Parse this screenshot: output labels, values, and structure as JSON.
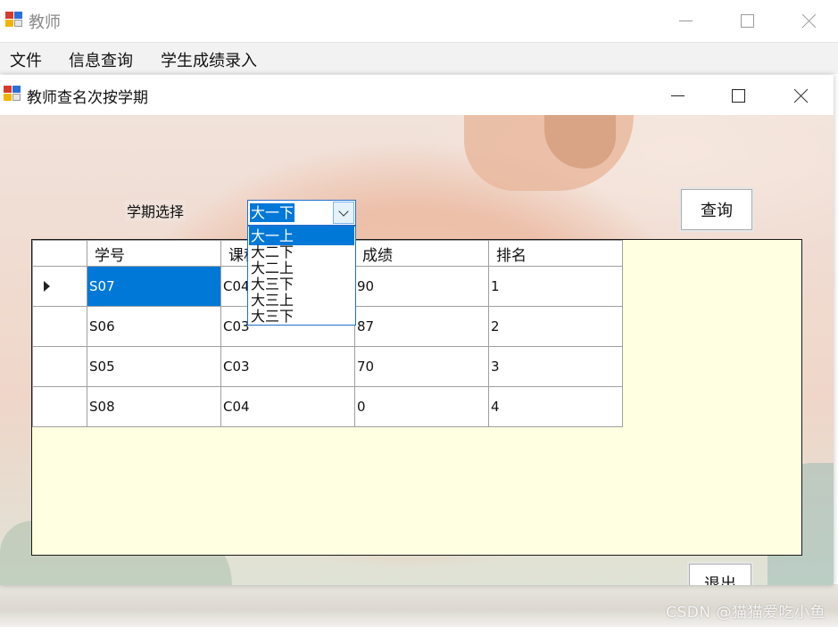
{
  "outer_window": {
    "title": "教师",
    "menu": [
      "文件",
      "信息查询",
      "学生成绩录入"
    ]
  },
  "child_window": {
    "title": "教师查名次按学期",
    "term_label": "学期选择",
    "term_combo": {
      "selected": "大一下",
      "options": [
        "大一上",
        "大二下",
        "大二上",
        "大三下",
        "大三上",
        "大三下"
      ]
    },
    "query_button": "查询",
    "exit_button": "退出",
    "grid": {
      "columns": [
        "学号",
        "课程",
        "成绩",
        "排名"
      ],
      "rows": [
        [
          "S07",
          "C04",
          "90",
          "1"
        ],
        [
          "S06",
          "C03",
          "87",
          "2"
        ],
        [
          "S05",
          "C03",
          "70",
          "3"
        ],
        [
          "S08",
          "C04",
          "0",
          "4"
        ]
      ]
    }
  },
  "watermark": "CSDN @猫猫爱吃小鱼",
  "colors": {
    "selection": "#0078d7",
    "grid_background": "#ffffe1",
    "combo_border": "#1f6fd0"
  },
  "icons": [
    "app-icon",
    "minimize-icon",
    "maximize-icon",
    "close-icon",
    "chevron-down-icon",
    "row-pointer-icon"
  ]
}
